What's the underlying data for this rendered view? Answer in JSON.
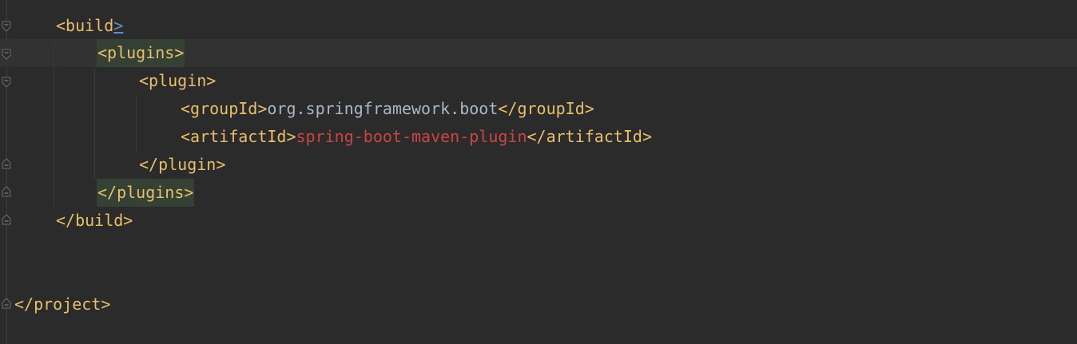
{
  "editor": {
    "lines": [
      {
        "open": "<build",
        "close_bracket": ">"
      },
      {
        "tag": "<plugins>"
      },
      {
        "tag": "<plugin>"
      },
      {
        "open": "<groupId>",
        "value": "org.springframework.boot",
        "close": "</groupId>"
      },
      {
        "open": "<artifactId>",
        "value": "spring-boot-maven-plugin",
        "close": "</artifactId>"
      },
      {
        "tag": "</plugin>"
      },
      {
        "tag": "</plugins>"
      },
      {
        "tag": "</build>"
      },
      {
        "tag": "</project>"
      }
    ]
  }
}
